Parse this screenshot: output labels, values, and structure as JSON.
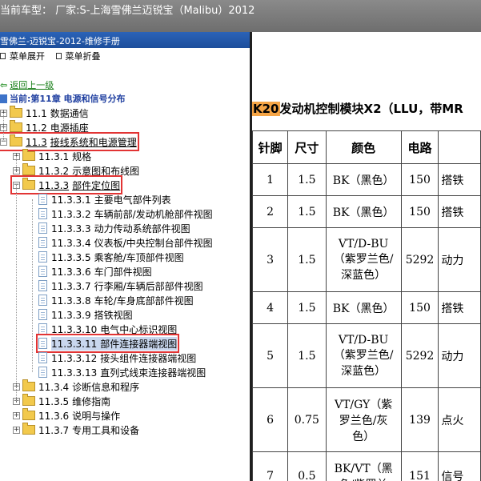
{
  "topbar": {
    "title": "当前车型： 厂家:S-上海雪佛兰迈锐宝（Malibu）2012"
  },
  "left_panel": {
    "header": "雪佛兰-迈锐宝-2012-维修手册",
    "menu": {
      "expand": "菜单展开",
      "collapse": "菜单折叠"
    },
    "back_link": "返回上一级",
    "current": "当前:第11章 电源和信号分布"
  },
  "tree": [
    {
      "num": "11.1",
      "label": "数据通信",
      "kind": "folder",
      "level": 0,
      "state": "collapsed"
    },
    {
      "num": "11.2",
      "label": "电源插座",
      "kind": "folder",
      "level": 0,
      "state": "collapsed"
    },
    {
      "num": "11.3",
      "label": "接线系统和电源管理",
      "kind": "folder",
      "level": 0,
      "state": "expanded",
      "highlight": true
    },
    {
      "num": "11.3.1",
      "label": "规格",
      "kind": "folder",
      "level": 1,
      "state": "collapsed"
    },
    {
      "num": "11.3.2",
      "label": "示意图和布线图",
      "kind": "folder",
      "level": 1,
      "state": "collapsed"
    },
    {
      "num": "11.3.3",
      "label": "部件定位图",
      "kind": "folder",
      "level": 1,
      "state": "expanded",
      "highlight": true
    },
    {
      "num": "11.3.3.1",
      "label": "主要电气部件列表",
      "kind": "page",
      "level": 2
    },
    {
      "num": "11.3.3.2",
      "label": "车辆前部/发动机舱部件视图",
      "kind": "page",
      "level": 2
    },
    {
      "num": "11.3.3.3",
      "label": "动力传动系统部件视图",
      "kind": "page",
      "level": 2
    },
    {
      "num": "11.3.3.4",
      "label": "仪表板/中央控制台部件视图",
      "kind": "page",
      "level": 2
    },
    {
      "num": "11.3.3.5",
      "label": "乘客舱/车顶部件视图",
      "kind": "page",
      "level": 2
    },
    {
      "num": "11.3.3.6",
      "label": "车门部件视图",
      "kind": "page",
      "level": 2
    },
    {
      "num": "11.3.3.7",
      "label": "行李厢/车辆后部部件视图",
      "kind": "page",
      "level": 2
    },
    {
      "num": "11.3.3.8",
      "label": "车轮/车身底部部件视图",
      "kind": "page",
      "level": 2
    },
    {
      "num": "11.3.3.9",
      "label": "搭铁视图",
      "kind": "page",
      "level": 2
    },
    {
      "num": "11.3.3.10",
      "label": "电气中心标识视图",
      "kind": "page",
      "level": 2
    },
    {
      "num": "11.3.3.11",
      "label": "部件连接器端视图",
      "kind": "page",
      "level": 2,
      "highlight": true,
      "selected": true
    },
    {
      "num": "11.3.3.12",
      "label": "接头组件连接器端视图",
      "kind": "page",
      "level": 2
    },
    {
      "num": "11.3.3.13",
      "label": "直列式线束连接器端视图",
      "kind": "page",
      "level": 2
    },
    {
      "num": "11.3.4",
      "label": "诊断信息和程序",
      "kind": "folder",
      "level": 1,
      "state": "collapsed"
    },
    {
      "num": "11.3.5",
      "label": "维修指南",
      "kind": "folder",
      "level": 1,
      "state": "collapsed"
    },
    {
      "num": "11.3.6",
      "label": "说明与操作",
      "kind": "folder",
      "level": 1,
      "state": "collapsed"
    },
    {
      "num": "11.3.7",
      "label": "专用工具和设备",
      "kind": "folder",
      "level": 1,
      "state": "collapsed"
    }
  ],
  "content": {
    "title_code": "K20",
    "title_rest": "发动机控制模块X2（LLU，带MR",
    "columns": [
      "针脚",
      "尺寸",
      "颜色",
      "电路",
      ""
    ],
    "rows": [
      {
        "pin": "1",
        "size": "1.5",
        "color": "BK（黑色）",
        "circuit": "150",
        "func": "搭铁"
      },
      {
        "pin": "2",
        "size": "1.5",
        "color": "BK（黑色）",
        "circuit": "150",
        "func": "搭铁"
      },
      {
        "pin": "3",
        "size": "1.5",
        "color": "VT/D-BU（紫罗兰色/深蓝色）",
        "circuit": "5292",
        "func": "动力"
      },
      {
        "pin": "4",
        "size": "1.5",
        "color": "BK（黑色）",
        "circuit": "150",
        "func": "搭铁"
      },
      {
        "pin": "5",
        "size": "1.5",
        "color": "VT/D-BU（紫罗兰色/深蓝色）",
        "circuit": "5292",
        "func": "动力"
      },
      {
        "pin": "6",
        "size": "0.75",
        "color": "VT/GY（紫罗兰色/灰色）",
        "circuit": "139",
        "func": "点火"
      },
      {
        "pin": "7",
        "size": "0.5",
        "color": "BK/VT（黑色/紫罗兰",
        "circuit": "151",
        "func": "信号"
      }
    ]
  }
}
